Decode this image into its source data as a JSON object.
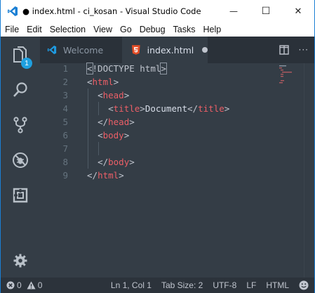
{
  "titlebar": {
    "title": "● index.html - ci_kosan - Visual Studio Code",
    "minimize": "—",
    "maximize": "☐",
    "close": "✕"
  },
  "menu": {
    "items": [
      "File",
      "Edit",
      "Selection",
      "View",
      "Go",
      "Debug",
      "Tasks",
      "Help"
    ]
  },
  "activitybar": {
    "explorer_badge": "1"
  },
  "tabs": {
    "welcome_label": "Welcome",
    "index_label": "index.html",
    "more_actions": "···"
  },
  "editor": {
    "line_numbers": [
      "1",
      "2",
      "3",
      "4",
      "5",
      "6",
      "7",
      "8",
      "9"
    ],
    "doctype": "!DOCTYPE html",
    "html": "html",
    "head": "head",
    "title": "title",
    "title_text": "Document",
    "body": "body"
  },
  "status": {
    "errors": "0",
    "warnings": "0",
    "cursor": "Ln 1, Col 1",
    "tab_size": "Tab Size: 2",
    "encoding": "UTF-8",
    "eol": "LF",
    "language": "HTML"
  },
  "colors": {
    "editor_bg": "#343d46",
    "tag": "#ec5f67",
    "line_number": "#65737e",
    "accent": "#1fa0e0"
  }
}
